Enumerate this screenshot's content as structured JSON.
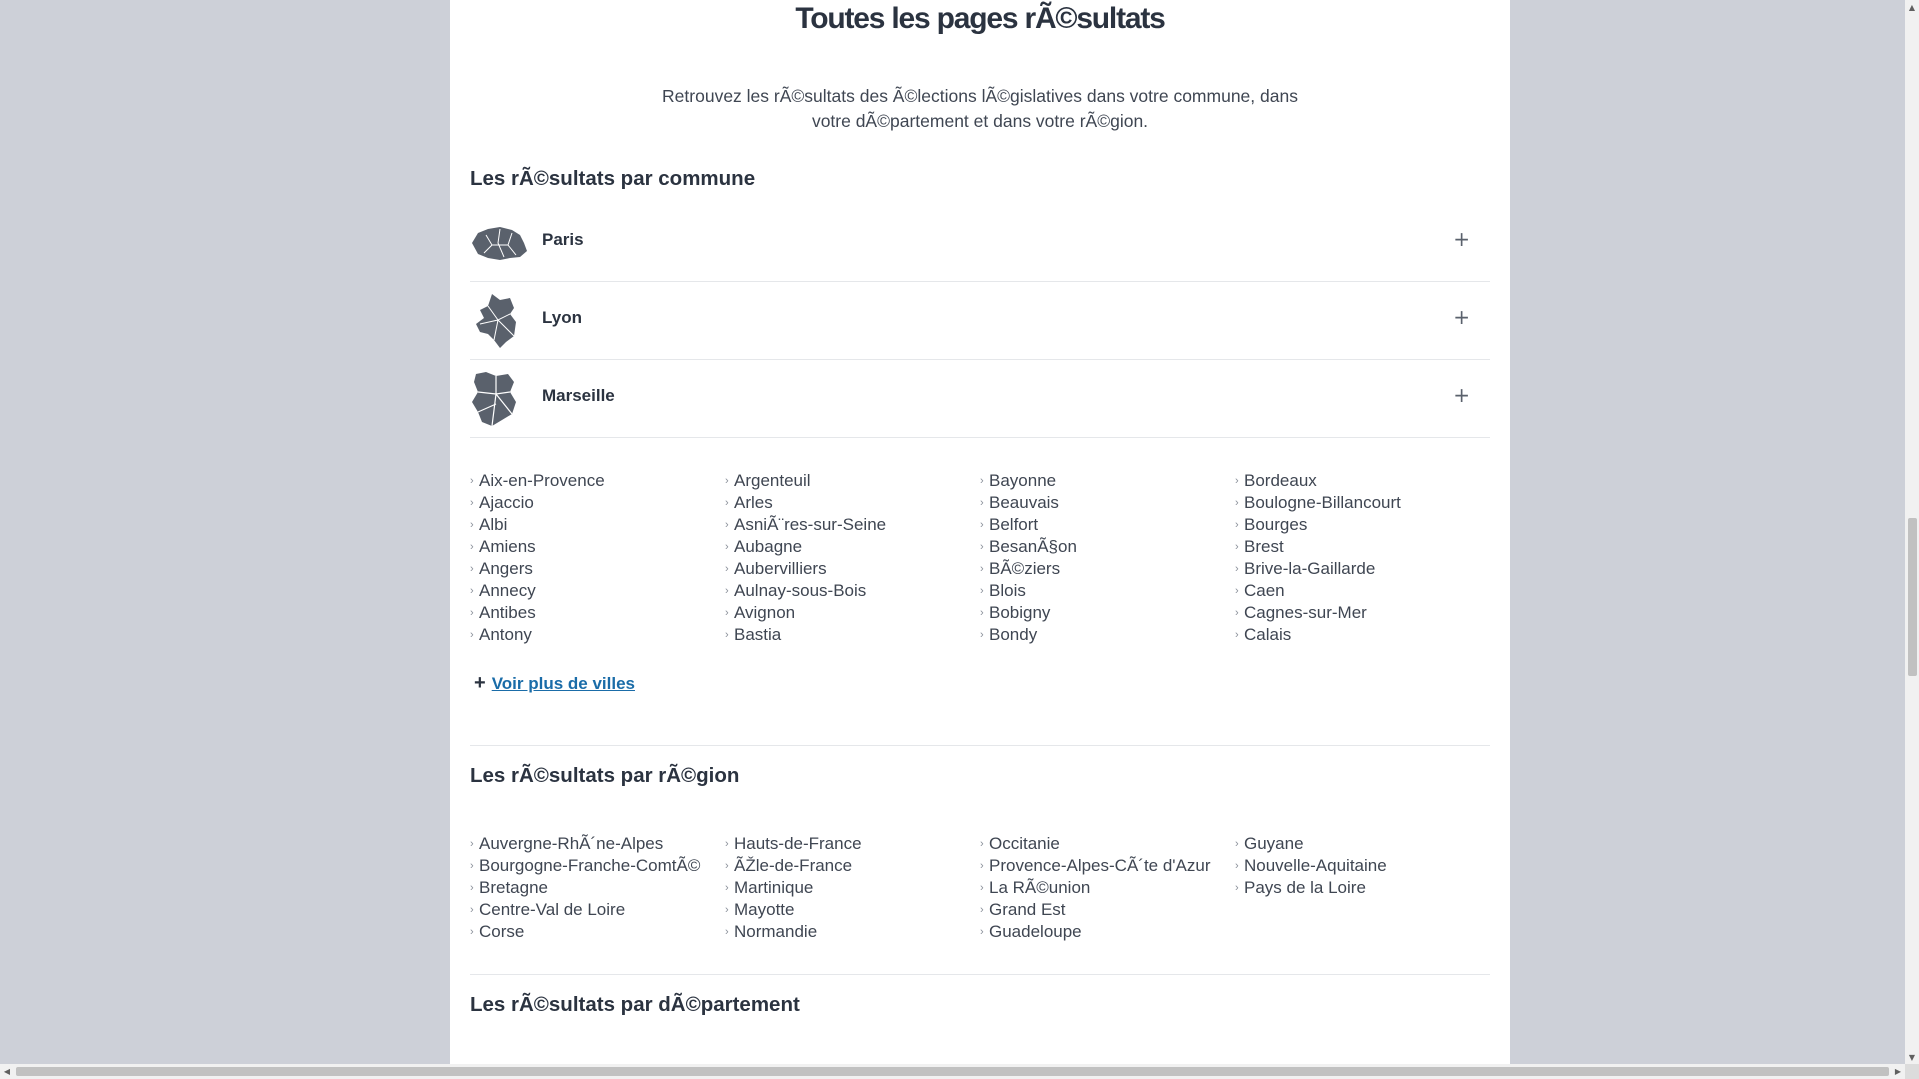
{
  "header": {
    "title": "Toutes les pages rÃ©sultats",
    "intro": "Retrouvez les rÃ©sultats des Ã©lections lÃ©gislatives dans votre commune, dans votre dÃ©partement et dans votre rÃ©gion."
  },
  "commune_section": {
    "title": "Les rÃ©sultats par commune",
    "accordions": [
      {
        "label": "Paris",
        "toggle": "+",
        "icon": "paris-map-icon"
      },
      {
        "label": "Lyon",
        "toggle": "+",
        "icon": "lyon-map-icon"
      },
      {
        "label": "Marseille",
        "toggle": "+",
        "icon": "marseille-map-icon"
      }
    ],
    "cities": [
      "Aix-en-Provence",
      "Ajaccio",
      "Albi",
      "Amiens",
      "Angers",
      "Annecy",
      "Antibes",
      "Antony",
      "Argenteuil",
      "Arles",
      "AsniÃ¨res-sur-Seine",
      "Aubagne",
      "Aubervilliers",
      "Aulnay-sous-Bois",
      "Avignon",
      "Bastia",
      "Bayonne",
      "Beauvais",
      "Belfort",
      "BesanÃ§on",
      "BÃ©ziers",
      "Blois",
      "Bobigny",
      "Bondy",
      "Bordeaux",
      "Boulogne-Billancourt",
      "Bourges",
      "Brest",
      "Brive-la-Gaillarde",
      "Caen",
      "Cagnes-sur-Mer",
      "Calais"
    ],
    "more_label": "Voir plus de villes",
    "more_icon": "plus-icon"
  },
  "region_section": {
    "title": "Les rÃ©sultats par rÃ©gion",
    "regions": [
      "Auvergne-RhÃ´ne-Alpes",
      "Bourgogne-Franche-ComtÃ©",
      "Bretagne",
      "Centre-Val de Loire",
      "Corse",
      "Hauts-de-France",
      "ÃŽle-de-France",
      "Martinique",
      "Mayotte",
      "Normandie",
      "Occitanie",
      "Provence-Alpes-CÃ´te d'Azur",
      "La RÃ©union",
      "Grand Est",
      "Guadeloupe",
      "Guyane",
      "Nouvelle-Aquitaine",
      "Pays de la Loire"
    ]
  },
  "departement_section": {
    "title": "Les rÃ©sultats par dÃ©partement"
  },
  "colors": {
    "background": "#cdd0d8",
    "panel": "#ffffff",
    "text": "#2b3340",
    "link": "#1a6ca8",
    "map_fill": "#5a616c"
  }
}
